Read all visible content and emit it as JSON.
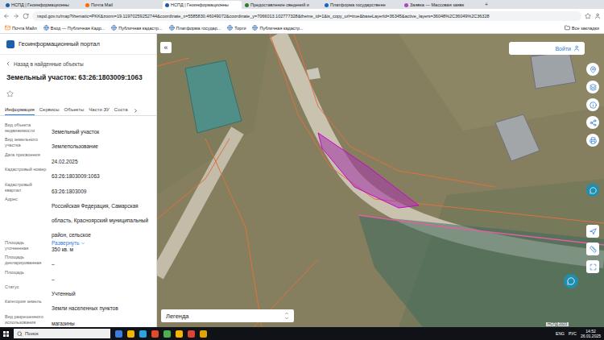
{
  "browser": {
    "tabs": [
      {
        "label": "НСПД | Геоинформационны",
        "selected": false
      },
      {
        "label": "Почта Mail",
        "selected": false
      },
      {
        "label": "НСПД | Геоинформационны",
        "selected": true
      },
      {
        "label": "Предоставление сведений и",
        "selected": false
      },
      {
        "label": "Платформа государственн",
        "selected": false
      },
      {
        "label": "Заявка — Массовая заявк",
        "selected": false
      }
    ],
    "new_tab": "+",
    "address": "nspd.gov.ru/map?thematic=PKK&zoom=19.11970259252744&coordinate_x=5585830.46049072&coordinate_y=7066013.102777328&theme_id=1&is_copy_url=true&baseLayerId=36345&active_layers=36048%2C36049%2C36328",
    "bookmarks": [
      "Почта Майл",
      "Вход — Публичная Кадр...",
      "Публичная кадастр...",
      "Платформа государ...",
      "Торги",
      "Публичная кадастр..."
    ],
    "all_bookmarks": "Все закладки"
  },
  "portal": {
    "title": "Геоинформационный портал",
    "login": "Войти"
  },
  "panel": {
    "back": "Назад в найденные объекты",
    "title": "Земельный участок: 63:26:1803009:1063",
    "favorite": false,
    "tabs": [
      {
        "label": "Информация",
        "selected": true
      },
      {
        "label": "Сервисы",
        "selected": false
      },
      {
        "label": "Объекты",
        "selected": false
      },
      {
        "label": "Части ЗУ",
        "selected": false
      },
      {
        "label": "Соста",
        "selected": false
      }
    ],
    "fields": [
      {
        "label": "Вид объекта недвижимости",
        "value": "Земельный участок"
      },
      {
        "label": "Вид земельного участка",
        "value": "Землепользование"
      },
      {
        "label": "Дата присвоения",
        "value": "24.02.2025"
      },
      {
        "label": "Кадастровый номер",
        "value": "63:26:1803009:1063"
      },
      {
        "label": "Кадастровый квартал",
        "value": "63:26:1803009"
      },
      {
        "label": "Адрес",
        "value": "Российская Федерация, Самарская область, Красноярский муниципальный район, сельское"
      },
      {
        "label": "Площадь уточненная",
        "value": "350 кв. м"
      },
      {
        "label": "Площадь декларированная",
        "value": "–"
      },
      {
        "label": "Площадь",
        "value": "–"
      },
      {
        "label": "Статус",
        "value": "Учтенный"
      },
      {
        "label": "Категория земель",
        "value": "Земли населенных пунктов"
      },
      {
        "label": "Вид разрешенного использования",
        "value": "магазины"
      }
    ],
    "expand": "Развернуть"
  },
  "map": {
    "collapse": "«",
    "legend": "Легенда",
    "attribution": "НСПД 2023"
  },
  "taskbar": {
    "search": "Поиск",
    "language_en": "ENG",
    "language_ru": "РУС",
    "time": "14:52",
    "date": "26.01.2025"
  }
}
